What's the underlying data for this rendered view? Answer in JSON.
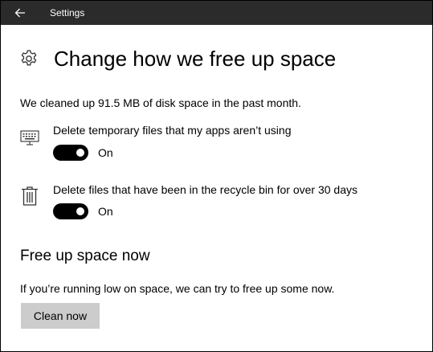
{
  "window": {
    "title": "Settings"
  },
  "icons": {
    "back": "back-arrow-icon",
    "page": "gear-icon",
    "option1": "keyboard-icon",
    "option2": "trash-icon"
  },
  "page": {
    "title": "Change how we free up space",
    "summary": "We cleaned up 91.5 MB of disk space in the past month."
  },
  "options": [
    {
      "label": "Delete temporary files that my apps aren’t using",
      "state": "On",
      "on": true
    },
    {
      "label": "Delete files that have been in the recycle bin for over 30 days",
      "state": "On",
      "on": true
    }
  ],
  "free_up_now": {
    "title": "Free up space now",
    "description": "If you’re running low on space, we can try to free up some now.",
    "button_label": "Clean now"
  },
  "colors": {
    "titlebar": "#2b2b2b",
    "toggle_on": "#000000",
    "button": "#cccccc"
  }
}
